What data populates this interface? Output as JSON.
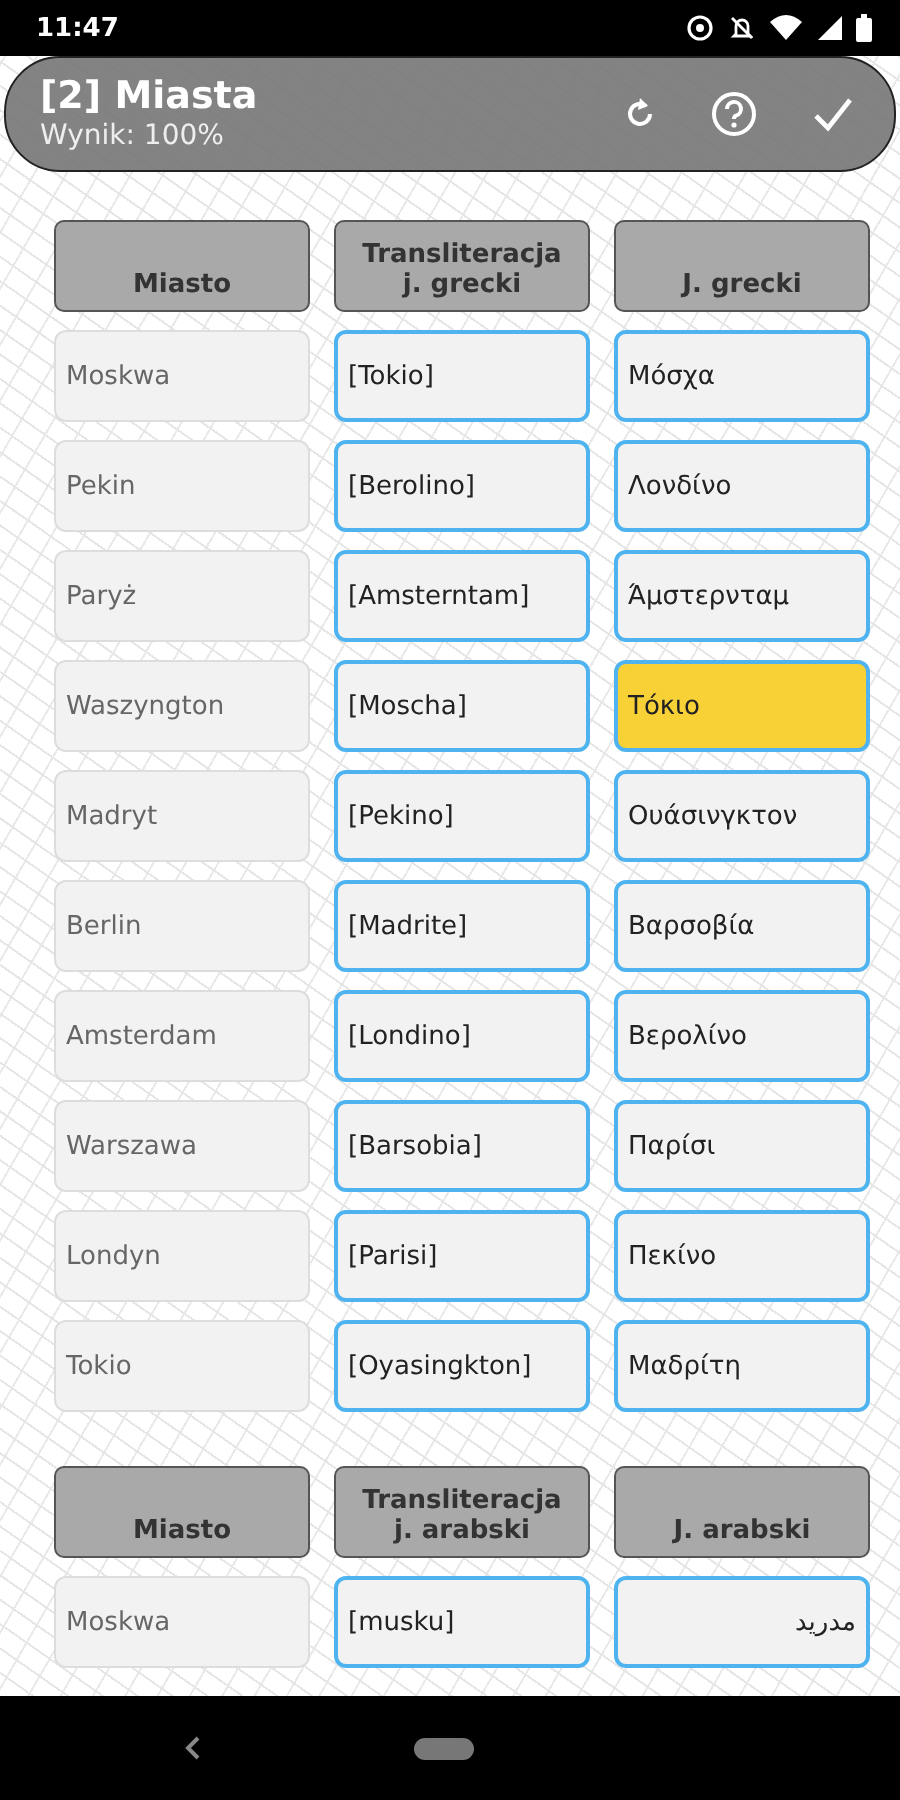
{
  "status_bar": {
    "time": "11:47"
  },
  "header": {
    "title": "[2] Miasta",
    "score": "Wynik: 100%"
  },
  "sections": [
    {
      "columns": [
        "Miasto",
        "Transliteracja\nj. grecki",
        "J. grecki"
      ],
      "rows": [
        {
          "city": "Moskwa",
          "transliteration": "[Tokio]",
          "native": "Μόσχα",
          "highlighted": false
        },
        {
          "city": "Pekin",
          "transliteration": "[Berolino]",
          "native": "Λονδίνο",
          "highlighted": false
        },
        {
          "city": "Paryż",
          "transliteration": "[Amsterntam]",
          "native": "Άμστερνταμ",
          "highlighted": false
        },
        {
          "city": "Waszyngton",
          "transliteration": "[Moscha]",
          "native": "Τόκιο",
          "highlighted": true
        },
        {
          "city": "Madryt",
          "transliteration": "[Pekino]",
          "native": "Ουάσινγκτον",
          "highlighted": false
        },
        {
          "city": "Berlin",
          "transliteration": "[Madrite]",
          "native": "Βαρσοβία",
          "highlighted": false
        },
        {
          "city": "Amsterdam",
          "transliteration": "[Londino]",
          "native": "Βερολίνο",
          "highlighted": false
        },
        {
          "city": "Warszawa",
          "transliteration": "[Barsobia]",
          "native": "Παρίσι",
          "highlighted": false
        },
        {
          "city": "Londyn",
          "transliteration": "[Parisi]",
          "native": "Πεκίνο",
          "highlighted": false
        },
        {
          "city": "Tokio",
          "transliteration": "[Oyasingkton]",
          "native": "Μαδρίτη",
          "highlighted": false
        }
      ]
    },
    {
      "columns": [
        "Miasto",
        "Transliteracja\nj. arabski",
        "J. arabski"
      ],
      "rows": [
        {
          "city": "Moskwa",
          "transliteration": "[musku]",
          "native": "مدريد",
          "highlighted": false
        }
      ]
    }
  ]
}
